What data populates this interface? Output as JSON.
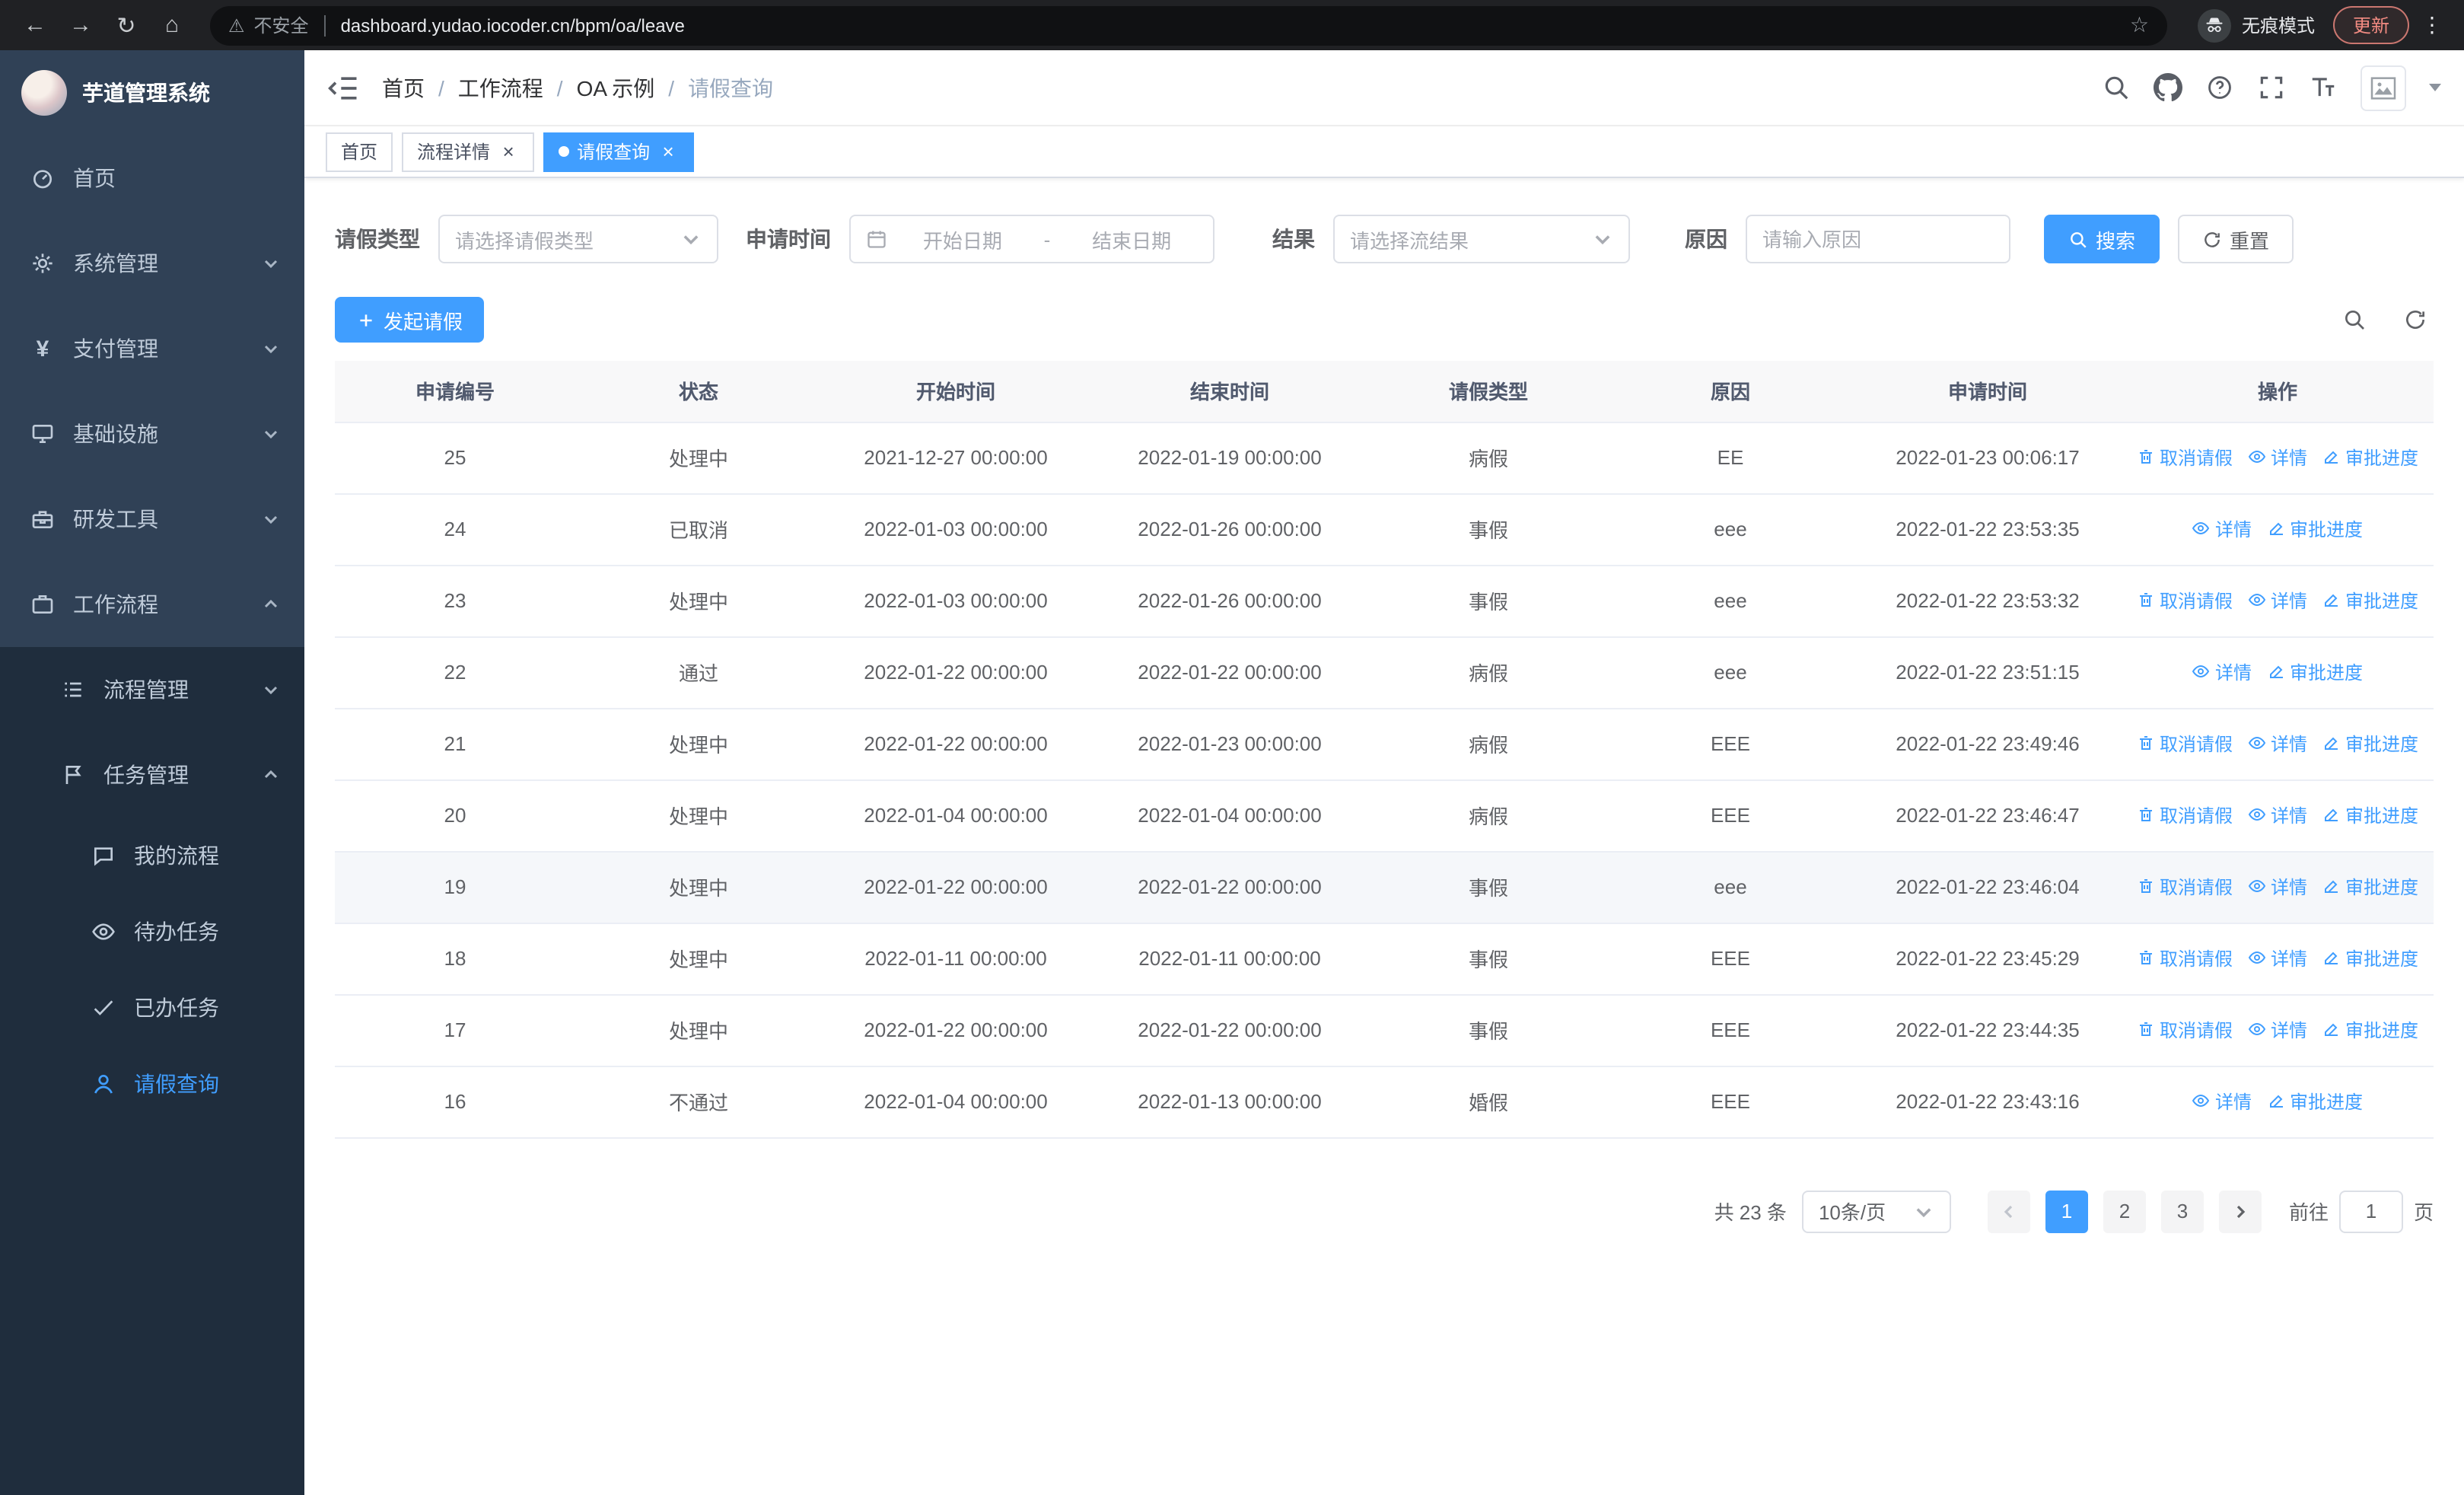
{
  "colors": {
    "primary": "#409eff",
    "sidebar_bg": "#304156",
    "submenu_bg": "#1f2d3d"
  },
  "icons": {
    "back": "←",
    "forward": "→",
    "reload": "↻",
    "home": "⌂",
    "warning": "⚠",
    "star": "☆",
    "kebab": "⋮",
    "yen": "¥",
    "close": "×"
  },
  "browser": {
    "security_label": "不安全",
    "url": "dashboard.yudao.iocoder.cn/bpm/oa/leave",
    "incognito_label": "无痕模式",
    "update_label": "更新"
  },
  "sidebar": {
    "logo_title": "芋道管理系统",
    "items": [
      {
        "label": "首页"
      },
      {
        "label": "系统管理"
      },
      {
        "label": "支付管理"
      },
      {
        "label": "基础设施"
      },
      {
        "label": "研发工具"
      },
      {
        "label": "工作流程"
      }
    ],
    "workflow_children": [
      {
        "label": "流程管理"
      },
      {
        "label": "任务管理"
      }
    ],
    "task_children": [
      {
        "label": "我的流程"
      },
      {
        "label": "待办任务"
      },
      {
        "label": "已办任务"
      },
      {
        "label": "请假查询"
      }
    ]
  },
  "header": {
    "breadcrumb": [
      "首页",
      "工作流程",
      "OA 示例",
      "请假查询"
    ],
    "breadcrumb_separator": "/"
  },
  "tabs": [
    {
      "label": "首页",
      "closable": false,
      "active": false
    },
    {
      "label": "流程详情",
      "closable": true,
      "active": false
    },
    {
      "label": "请假查询",
      "closable": true,
      "active": true
    }
  ],
  "filters": {
    "leave_type_label": "请假类型",
    "leave_type_placeholder": "请选择请假类型",
    "apply_time_label": "申请时间",
    "start_date_placeholder": "开始日期",
    "range_separator": "-",
    "end_date_placeholder": "结束日期",
    "result_label": "结果",
    "result_placeholder": "请选择流结果",
    "reason_label": "原因",
    "reason_placeholder": "请输入原因",
    "reason_value": "",
    "search_button": "搜索",
    "reset_button": "重置"
  },
  "toolbar": {
    "create_button": "发起请假"
  },
  "table": {
    "columns": [
      "申请编号",
      "状态",
      "开始时间",
      "结束时间",
      "请假类型",
      "原因",
      "申请时间",
      "操作"
    ],
    "actions": {
      "cancel": "取消请假",
      "detail": "详情",
      "progress": "审批进度"
    },
    "rows": [
      {
        "no": "25",
        "status": "处理中",
        "start": "2021-12-27 00:00:00",
        "end": "2022-01-19 00:00:00",
        "type": "病假",
        "reason": "EE",
        "applied": "2022-01-23 00:06:17",
        "cancellable": true,
        "highlighted": false
      },
      {
        "no": "24",
        "status": "已取消",
        "start": "2022-01-03 00:00:00",
        "end": "2022-01-26 00:00:00",
        "type": "事假",
        "reason": "eee",
        "applied": "2022-01-22 23:53:35",
        "cancellable": false,
        "highlighted": false
      },
      {
        "no": "23",
        "status": "处理中",
        "start": "2022-01-03 00:00:00",
        "end": "2022-01-26 00:00:00",
        "type": "事假",
        "reason": "eee",
        "applied": "2022-01-22 23:53:32",
        "cancellable": true,
        "highlighted": false
      },
      {
        "no": "22",
        "status": "通过",
        "start": "2022-01-22 00:00:00",
        "end": "2022-01-22 00:00:00",
        "type": "病假",
        "reason": "eee",
        "applied": "2022-01-22 23:51:15",
        "cancellable": false,
        "highlighted": false
      },
      {
        "no": "21",
        "status": "处理中",
        "start": "2022-01-22 00:00:00",
        "end": "2022-01-23 00:00:00",
        "type": "病假",
        "reason": "EEE",
        "applied": "2022-01-22 23:49:46",
        "cancellable": true,
        "highlighted": false
      },
      {
        "no": "20",
        "status": "处理中",
        "start": "2022-01-04 00:00:00",
        "end": "2022-01-04 00:00:00",
        "type": "病假",
        "reason": "EEE",
        "applied": "2022-01-22 23:46:47",
        "cancellable": true,
        "highlighted": false
      },
      {
        "no": "19",
        "status": "处理中",
        "start": "2022-01-22 00:00:00",
        "end": "2022-01-22 00:00:00",
        "type": "事假",
        "reason": "eee",
        "applied": "2022-01-22 23:46:04",
        "cancellable": true,
        "highlighted": true
      },
      {
        "no": "18",
        "status": "处理中",
        "start": "2022-01-11 00:00:00",
        "end": "2022-01-11 00:00:00",
        "type": "事假",
        "reason": "EEE",
        "applied": "2022-01-22 23:45:29",
        "cancellable": true,
        "highlighted": false
      },
      {
        "no": "17",
        "status": "处理中",
        "start": "2022-01-22 00:00:00",
        "end": "2022-01-22 00:00:00",
        "type": "事假",
        "reason": "EEE",
        "applied": "2022-01-22 23:44:35",
        "cancellable": true,
        "highlighted": false
      },
      {
        "no": "16",
        "status": "不通过",
        "start": "2022-01-04 00:00:00",
        "end": "2022-01-13 00:00:00",
        "type": "婚假",
        "reason": "EEE",
        "applied": "2022-01-22 23:43:16",
        "cancellable": false,
        "highlighted": false
      }
    ]
  },
  "pagination": {
    "total": "共 23 条",
    "page_size": "10条/页",
    "pages": [
      "1",
      "2",
      "3"
    ],
    "active_page": "1",
    "goto_label": "前往",
    "goto_value": "1",
    "goto_suffix": "页"
  }
}
